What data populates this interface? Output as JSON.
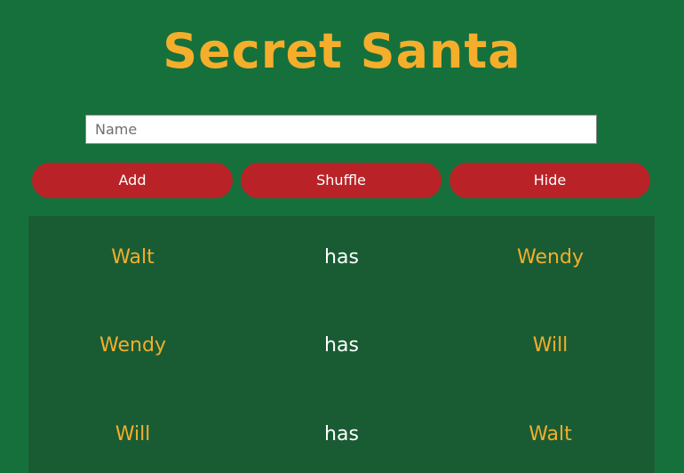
{
  "header": {
    "title": "Secret Santa"
  },
  "form": {
    "name_value": "",
    "name_placeholder": "Name",
    "buttons": {
      "add": "Add",
      "shuffle": "Shuffle",
      "hide": "Hide"
    }
  },
  "pairs": [
    {
      "giver": "Walt",
      "verb": "has",
      "receiver": "Wendy"
    },
    {
      "giver": "Wendy",
      "verb": "has",
      "receiver": "Will"
    },
    {
      "giver": "Will",
      "verb": "has",
      "receiver": "Walt"
    }
  ],
  "colors": {
    "background": "#16703c",
    "panel": "#195c34",
    "accent": "#f5ae2b",
    "button": "#b92328",
    "text": "#ffffff"
  }
}
